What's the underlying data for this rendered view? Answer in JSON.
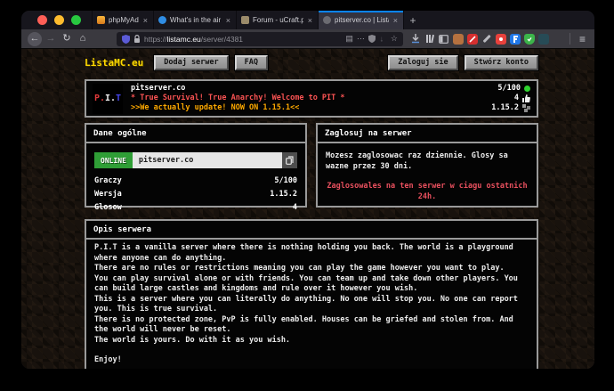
{
  "browser": {
    "tabs": [
      {
        "title": "phpMyAdmin"
      },
      {
        "title": "What's in the air you breathe? -"
      },
      {
        "title": "Forum - uCraft.pl | Forum Mine"
      },
      {
        "title": "pitserver.co | Lista Serwerów Mine"
      }
    ],
    "url_prefix": "https://",
    "url_domain": "listamc.eu",
    "url_path": "/server/4381",
    "glyphs": {
      "back": "←",
      "forward": "→",
      "reload": "↻",
      "home": "⌂",
      "reader": "▤",
      "more": "⋯",
      "star": "☆",
      "close": "×",
      "new_tab": "+",
      "menu": "≡"
    }
  },
  "site": {
    "logo": "ListaMC.eu",
    "nav_add_server": "Dodaj serwer",
    "nav_faq": "FAQ",
    "login": "Zaloguj sie",
    "register": "Stwórz konto"
  },
  "server": {
    "logo_p": "P.",
    "logo_i": "I.",
    "logo_t": "T",
    "name": "pitserver.co",
    "motd_line1": "* True Survival! True Anarchy! Welcome to PIT *",
    "motd_line2": ">>We actually update! NOW ON 1.15.1<<",
    "players": "5/100",
    "votes": "4",
    "version": "1.15.2"
  },
  "general_panel": {
    "title": "Dane ogólne",
    "status": "ONLINE",
    "address": "pitserver.co",
    "rows": [
      {
        "label": "Graczy",
        "value": "5/100"
      },
      {
        "label": "Wersja",
        "value": "1.15.2"
      },
      {
        "label": "Glosow",
        "value": "4"
      }
    ]
  },
  "vote_panel": {
    "title": "Zaglosuj na serwer",
    "info": "Mozesz zaglosowac raz dziennie. Glosy sa wazne przez 30 dni.",
    "alert": "Zaglosowales na ten serwer w ciagu ostatnich 24h."
  },
  "description_panel": {
    "title": "Opis serwera",
    "paragraphs": [
      "P.I.T is a vanilla server where there is nothing holding you back. The world is a playground where anyone can do anything.",
      "There are no rules or restrictions meaning you can play the game however you want to play.",
      "You can play survival alone or with friends. You can team up and take down other players. You can build large castles and kingdoms and rule over it however you wish.",
      "This is a server where you can literally do anything. No one will stop you. No one can report you. This is true survival.",
      "There is no protected zone, PvP is fully enabled. Houses can be griefed and stolen from. And the world will never be reset.",
      "The world is yours. Do with it as you wish.",
      "Enjoy!"
    ]
  },
  "colors": {
    "accent_yellow": "#ffd900",
    "motd_red": "#fc5454",
    "motd_gold": "#ffaa00",
    "online_green": "#2f9e36",
    "alert_red": "#e8505e",
    "active_tab_stripe": "#0a84ff"
  }
}
